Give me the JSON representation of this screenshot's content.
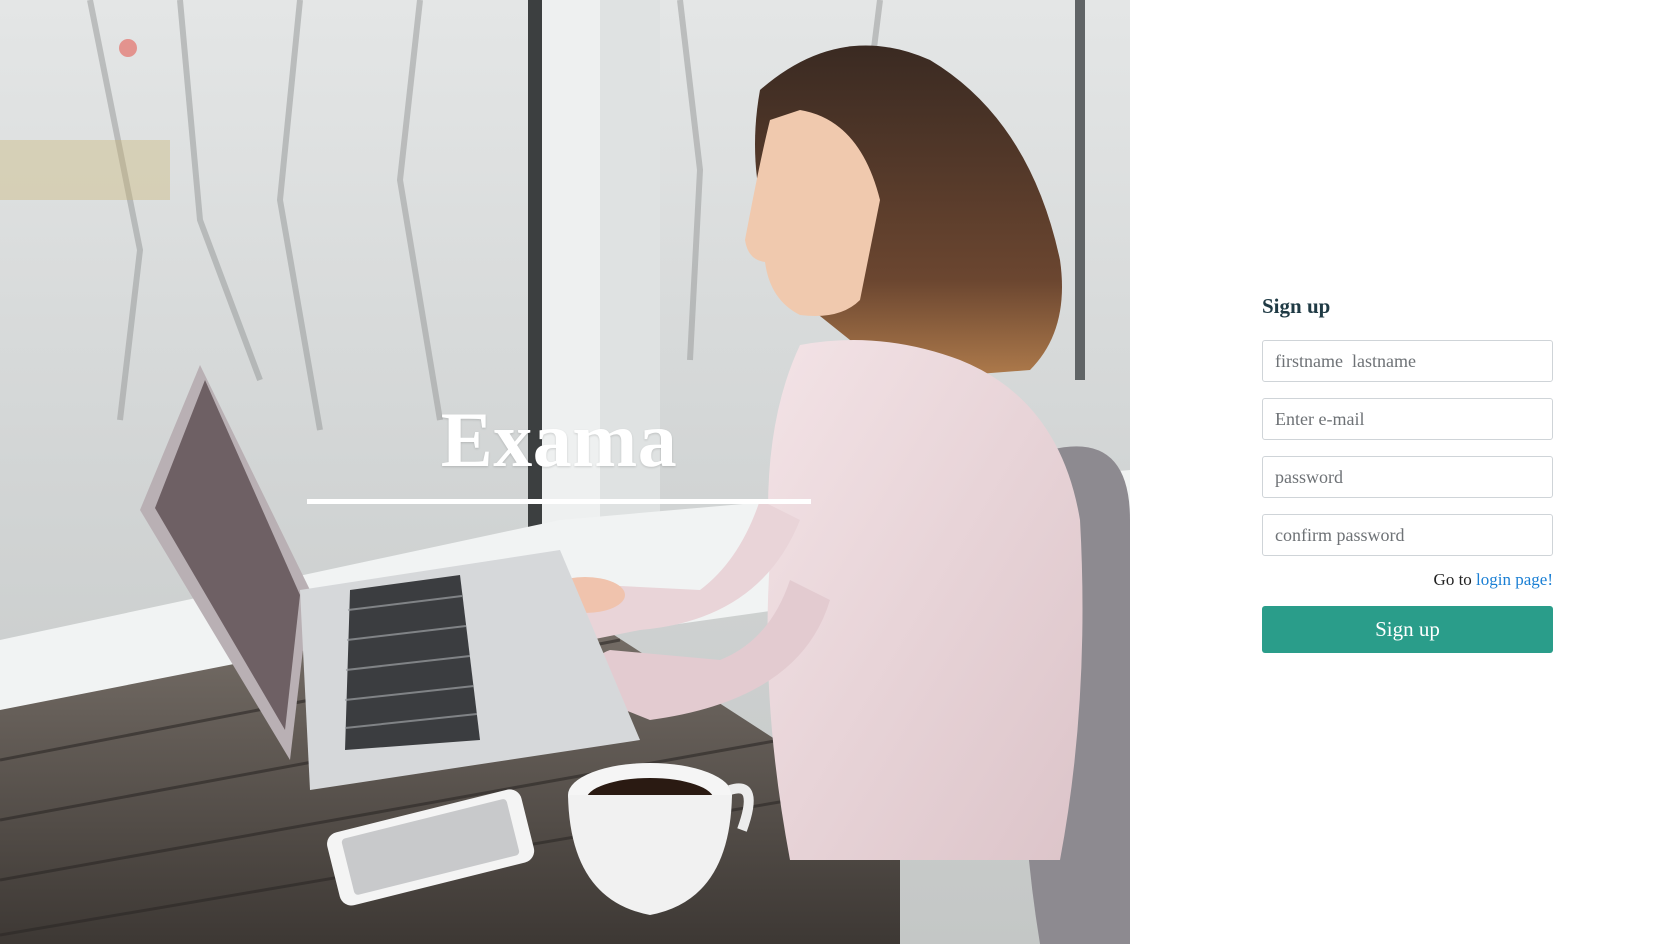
{
  "hero": {
    "brand_title": "Exama"
  },
  "signup": {
    "title": "Sign up",
    "fields": {
      "fullname_placeholder": "firstname  lastname",
      "email_placeholder": "Enter e-mail",
      "password_placeholder": "password",
      "confirm_placeholder": "confirm password"
    },
    "goto_prefix": "Go to",
    "login_link": "login page!",
    "submit_label": "Sign up"
  },
  "colors": {
    "accent_button": "#2a9d8a",
    "link": "#1a7fd4",
    "title_text": "#1f3a44"
  }
}
